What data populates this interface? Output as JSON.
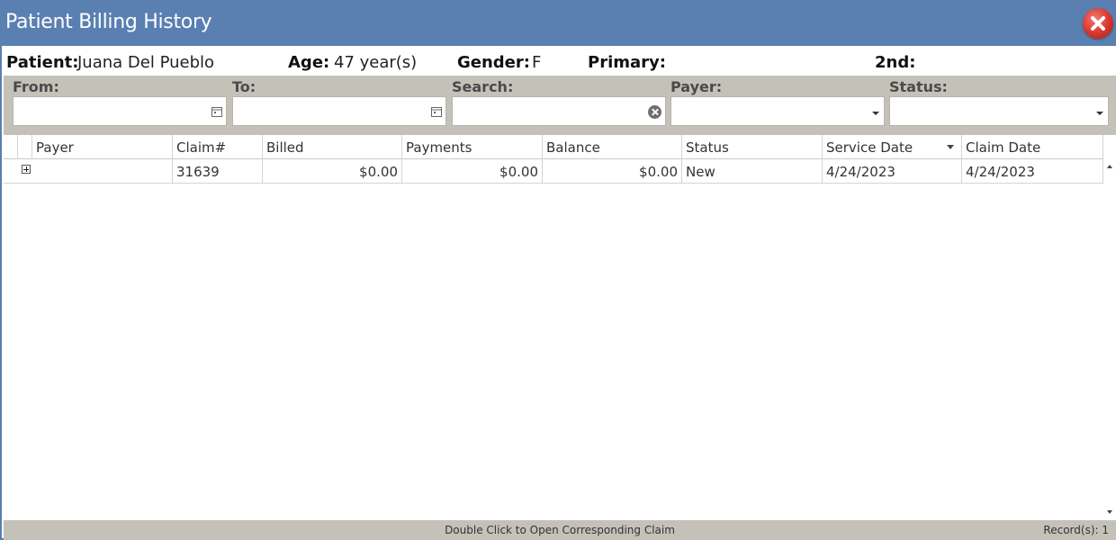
{
  "window": {
    "title": "Patient Billing History",
    "close_icon": "close-icon"
  },
  "patient": {
    "patient_label": "Patient:",
    "patient_value": "Juana Del Pueblo",
    "age_label": "Age:",
    "age_value": "47 year(s)",
    "gender_label": "Gender:",
    "gender_value": "F",
    "primary_label": "Primary:",
    "primary_value": "",
    "second_label": "2nd:",
    "second_value": ""
  },
  "filters": {
    "from_label": "From:",
    "from_value": "",
    "to_label": "To:",
    "to_value": "",
    "search_label": "Search:",
    "search_value": "",
    "payer_label": "Payer:",
    "payer_value": "",
    "status_label": "Status:",
    "status_value": ""
  },
  "grid": {
    "columns": [
      "Payer",
      "Claim#",
      "Billed",
      "Payments",
      "Balance",
      "Status",
      "Service Date",
      "Claim Date"
    ],
    "rows": [
      {
        "payer": "",
        "claim": "31639",
        "billed": "$0.00",
        "payments": "$0.00",
        "balance": "$0.00",
        "status": "New",
        "service_date": "4/24/2023",
        "claim_date": "4/24/2023"
      }
    ]
  },
  "statusbar": {
    "hint": "Double Click to Open Corresponding Claim",
    "records": "Record(s): 1"
  },
  "colors": {
    "titlebar": "#5a7fb1",
    "filterbar": "#c4c1b9",
    "close": "#d9342b"
  }
}
